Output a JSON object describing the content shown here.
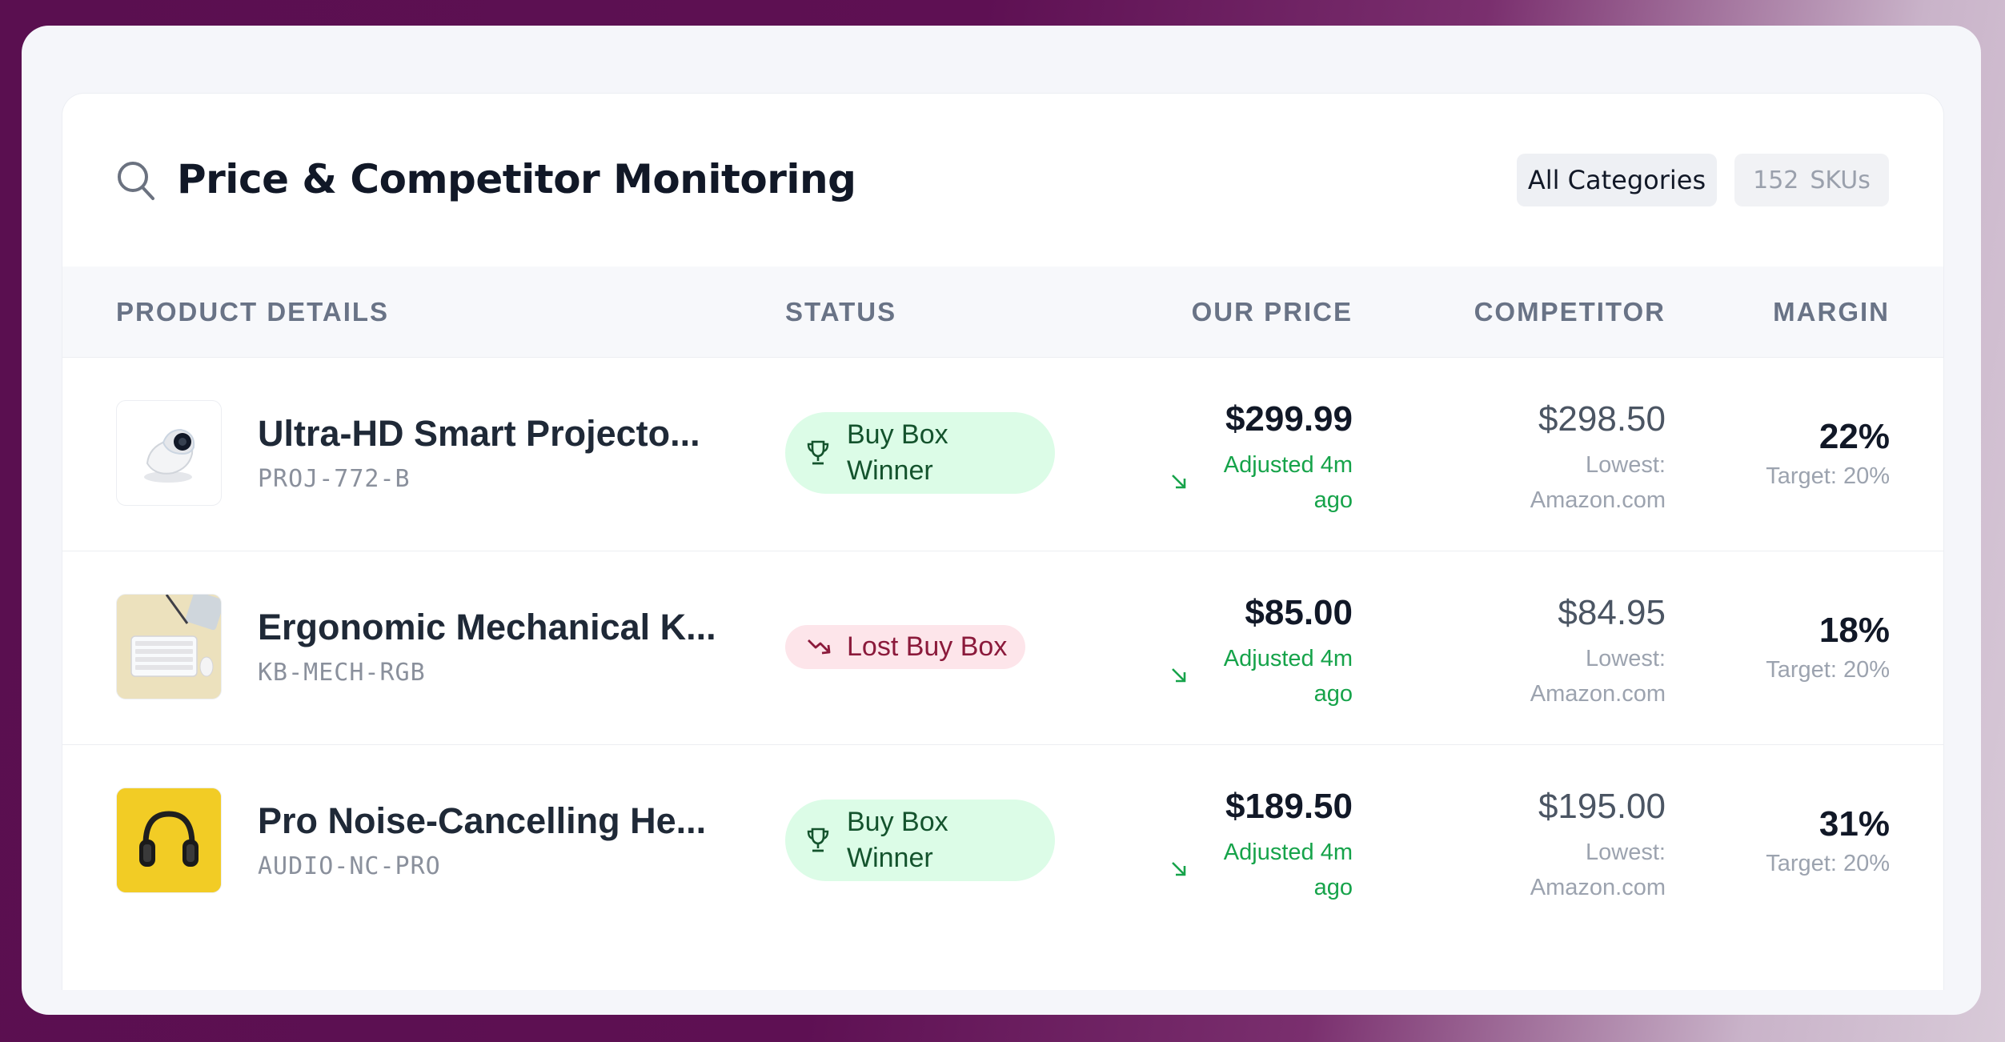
{
  "header": {
    "title": "Price & Competitor Monitoring",
    "category_label": "All Categories",
    "sku_count": "152",
    "sku_unit": "SKUs"
  },
  "columns": {
    "product": "PRODUCT DETAILS",
    "status": "STATUS",
    "our_price": "OUR PRICE",
    "competitor": "COMPETITOR",
    "margin": "MARGIN"
  },
  "rows": [
    {
      "name": "Ultra-HD Smart Projecto...",
      "sku": "PROJ-772-B",
      "thumb_icon": "projector-thumbnail",
      "status": "Buy Box Winner",
      "status_type": "win",
      "price": "$299.99",
      "adjusted": "Adjusted 4m ago",
      "competitor_price": "$298.50",
      "competitor_source": "Lowest: Amazon.com",
      "margin": "22%",
      "target": "Target: 20%"
    },
    {
      "name": "Ergonomic Mechanical K...",
      "sku": "KB-MECH-RGB",
      "thumb_icon": "keyboard-thumbnail",
      "status": "Lost Buy Box",
      "status_type": "lost",
      "price": "$85.00",
      "adjusted": "Adjusted 4m ago",
      "competitor_price": "$84.95",
      "competitor_source": "Lowest: Amazon.com",
      "margin": "18%",
      "target": "Target: 20%"
    },
    {
      "name": "Pro Noise-Cancelling He...",
      "sku": "AUDIO-NC-PRO",
      "thumb_icon": "headphones-thumbnail",
      "status": "Buy Box Winner",
      "status_type": "win",
      "price": "$189.50",
      "adjusted": "Adjusted 4m ago",
      "competitor_price": "$195.00",
      "competitor_source": "Lowest: Amazon.com",
      "margin": "31%",
      "target": "Target: 20%"
    }
  ],
  "colors": {
    "win_bg": "#dcfce7",
    "win_text": "#14532d",
    "lost_bg": "#fde5ea",
    "lost_text": "#8b1a3b",
    "adjusted_text": "#16a34a"
  }
}
